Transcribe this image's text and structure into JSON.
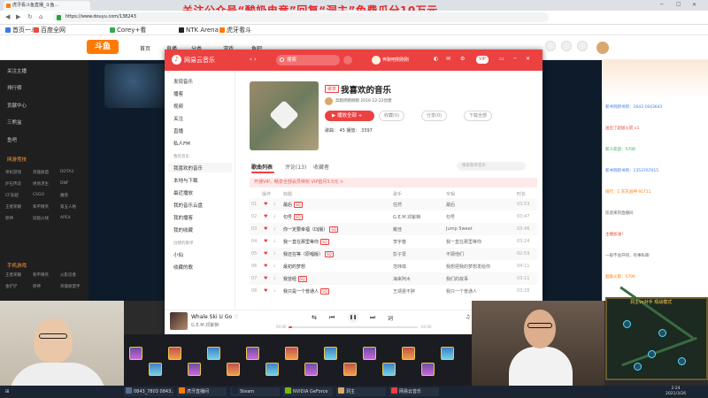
{
  "browser": {
    "tab_title": "虎牙看斗鱼直播_斗鱼...",
    "banner": "关注公众号“酸奶电竞”回复“洞主”免费瓜分10万元",
    "url": "https://www.douyu.com/138243",
    "bookmarks": [
      "首页一斗",
      "百度全网",
      "Corey+看",
      "NTK Arena",
      "虎牙看斗"
    ]
  },
  "douyu": {
    "logo": "斗鱼",
    "nav": [
      "首页",
      "直播",
      "分类",
      "游戏",
      "鱼吧"
    ]
  },
  "sidebar": {
    "items": [
      "关注主播",
      "排行榜",
      "贡献中心",
      "三熊盒",
      "鱼吧"
    ],
    "section1": "网游竞技",
    "grid1": [
      "单机游戏",
      "英雄联盟",
      "DOTA2",
      "炉石传说",
      "绝地求生",
      "DNF",
      "CF穿越",
      "CSGO",
      "魔兽",
      "王者荣耀",
      "和平精英",
      "第五人格",
      "原神",
      "穿越火线",
      "APEX"
    ],
    "section2": "手机游戏",
    "grid2": [
      "王者荣耀",
      "和平精英",
      "火影忍者",
      "金铲铲",
      "原神",
      "英雄联盟手"
    ]
  },
  "music": {
    "brand": "网易云音乐",
    "search_placeholder": "搜索",
    "username": "奔跑吧刚刚刚",
    "vip_label": "VIP",
    "sidebar": {
      "items": [
        "发现音乐",
        "播客",
        "视频",
        "关注",
        "直播",
        "私人FM"
      ],
      "section_mine": "我的音乐",
      "my_items": [
        "我喜欢的音乐",
        "本地与下载",
        "最近播放",
        "我的音乐云盘",
        "我的播客",
        "我的收藏"
      ],
      "section_created": "创建的歌单",
      "created_items": [
        "小仙",
        "收藏的歌"
      ]
    },
    "playlist": {
      "tag": "歌单",
      "title": "我喜欢的音乐",
      "owner": "奔跑吧刚刚刚  2016-12-22创建",
      "play_all": "播放全部",
      "collect": "收藏(0)",
      "share": "分享(0)",
      "download": "下载全部",
      "stats": "歌曲：  45   播放：  3397"
    },
    "tabs": [
      "歌曲列表",
      "评论(13)",
      "收藏者"
    ],
    "search_in_list": "搜索歌单音乐",
    "vip_bar": "开通VIP，畅享全部会员特权  VIP首月3.5元 >",
    "columns": [
      "操作",
      "标题",
      "歌手",
      "专辑",
      "时长"
    ],
    "songs": [
      {
        "no": "01",
        "title": "最后",
        "tag": "SQ",
        "artist": "任然",
        "album": "最后",
        "time": "03:53"
      },
      {
        "no": "02",
        "title": "句号",
        "tag": "SQ",
        "artist": "G.E.M.邓紫棋",
        "album": "句号",
        "time": "03:47"
      },
      {
        "no": "03",
        "title": "你一定要幸福（DJ版）",
        "tag": "SQ",
        "artist": "戴佳",
        "album": "Jump Sweet",
        "time": "03:46"
      },
      {
        "no": "04",
        "title": "我一直在那里等你",
        "tag": "SQ",
        "artist": "李宇春",
        "album": "我一直在那里等你",
        "time": "03:24"
      },
      {
        "no": "05",
        "title": "我还在等（原唱版）",
        "tag": "SQ",
        "artist": "彭子雷",
        "album": "不顾他们",
        "time": "02:59"
      },
      {
        "no": "06",
        "title": "最初的梦想",
        "tag": "",
        "artist": "范玮琪",
        "album": "我想把我的梦想发给你",
        "time": "04:11"
      },
      {
        "no": "07",
        "title": "我曾经",
        "tag": "SQ",
        "artist": "海来阿木",
        "album": "我们的故事",
        "time": "03:11"
      },
      {
        "no": "08",
        "title": "我只是一个普通人",
        "tag": "SQ",
        "artist": "王靖雯不胖",
        "album": "我只一个普通人",
        "time": "03:28"
      }
    ],
    "player": {
      "song": "Whale Ski U Go",
      "artist": "G.E.M.邓紫棋",
      "elapsed": "00:06",
      "duration": "03:00",
      "progress": 0.03,
      "lyric_btn": "词"
    }
  },
  "chat": {
    "lines": [
      "新书到新书到：1643 1643643",
      "送出了超级火箭 x1",
      "新人欢迎：5706",
      "新书到新书到：1353767015",
      "排行：1 灰灰战神 91711",
      "欢迎来到直播间",
      "主播加油！",
      "一般不会开喷，有事私聊",
      "超级火箭：5706"
    ]
  },
  "minimap": {
    "label": "洞主vs对手 观战模式"
  },
  "taskbar": {
    "items": [
      "0843_7803 0843...",
      "虎牙直播间",
      "Steam",
      "NVIDIA GeForce",
      "洞主",
      "网易云音乐"
    ],
    "time": "2:24",
    "date": "2021/3/26"
  },
  "colors": {
    "netease_red": "#ec4141",
    "douyu_orange": "#ff7a00",
    "banner_red": "#e6282a"
  }
}
